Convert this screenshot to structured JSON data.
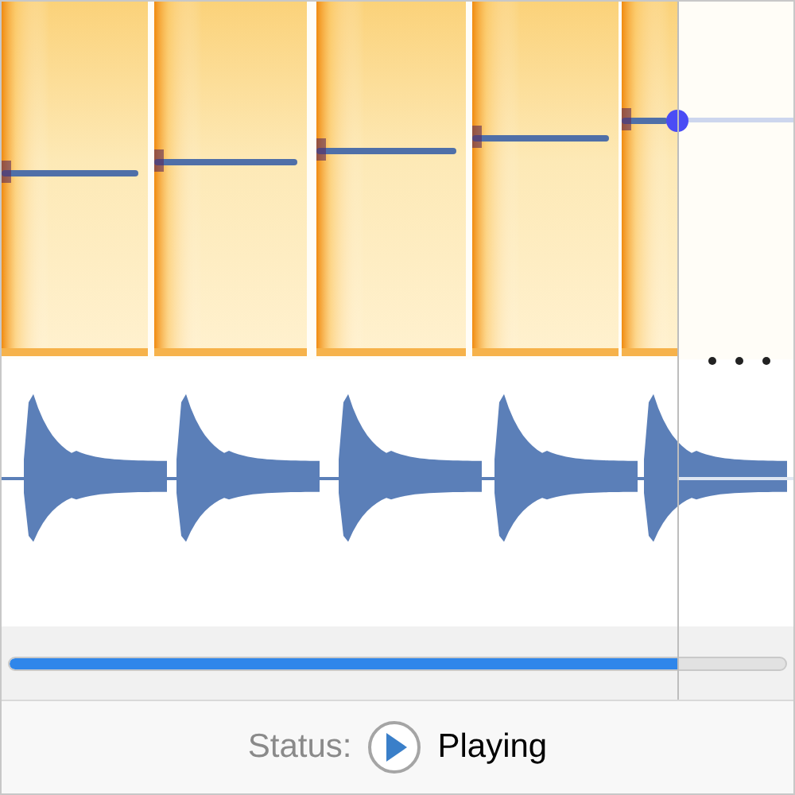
{
  "playback": {
    "level": 0.86
  },
  "status_bar": {
    "label": "Status:",
    "value": "Playing"
  }
}
